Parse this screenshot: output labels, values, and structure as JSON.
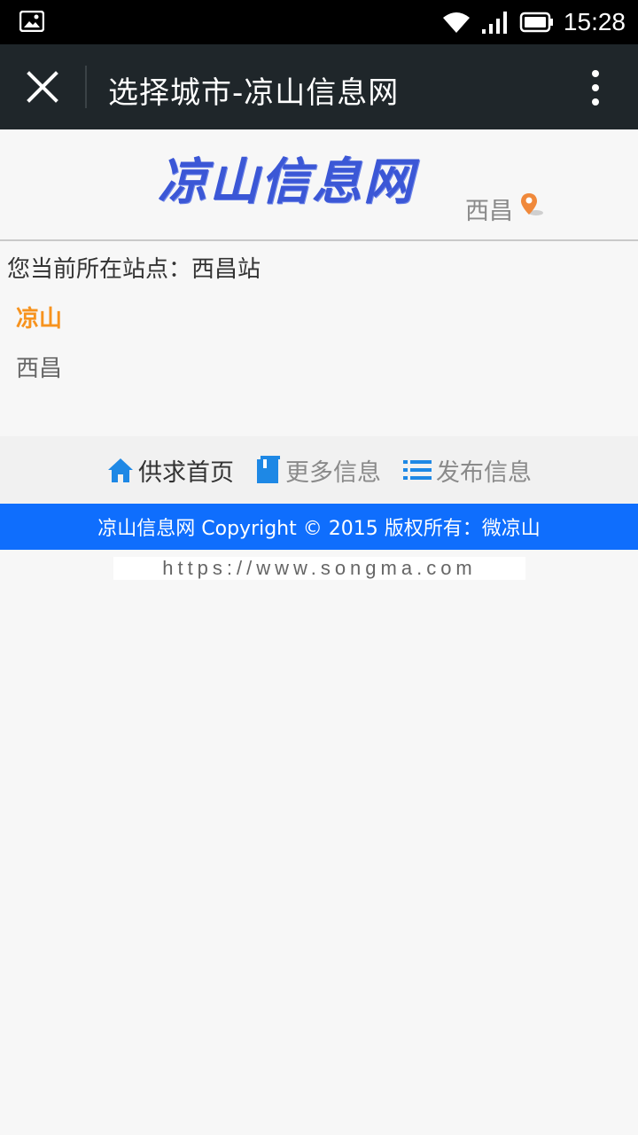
{
  "statusbar": {
    "time": "15:28"
  },
  "titlebar": {
    "title": "选择城市-凉山信息网"
  },
  "header": {
    "logo_text": "凉山信息网",
    "city": "西昌"
  },
  "current_site": "您当前所在站点：西昌站",
  "cities": {
    "province": "凉山",
    "items": [
      "西昌"
    ]
  },
  "bottomnav": {
    "home": "供求首页",
    "more": "更多信息",
    "publish": "发布信息"
  },
  "footer": {
    "copyright": "凉山信息网 Copyright © 2015 版权所有：微凉山",
    "url": "https://www.songma.com"
  },
  "colors": {
    "accent_orange": "#f7931e",
    "footer_blue": "#0f6efd",
    "nav_blue": "#1e88e5"
  }
}
